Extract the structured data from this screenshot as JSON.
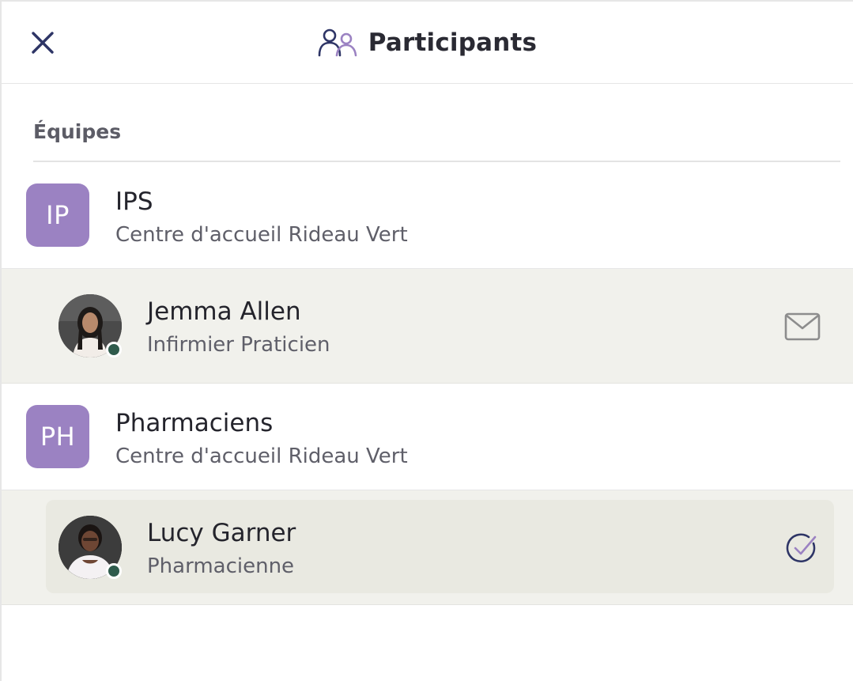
{
  "header": {
    "title": "Participants",
    "close_icon": "close-icon",
    "title_icon": "participants-icon"
  },
  "section": {
    "label": "Équipes"
  },
  "teams": [
    {
      "initials": "IP",
      "name": "IPS",
      "location": "Centre d'accueil Rideau Vert",
      "member": {
        "name": "Jemma Allen",
        "role": "Infirmier Praticien",
        "status": "online",
        "action_icon": "mail-icon"
      }
    },
    {
      "initials": "PH",
      "name": "Pharmaciens",
      "location": "Centre d'accueil Rideau Vert",
      "member": {
        "name": "Lucy Garner",
        "role": "Pharmacienne",
        "status": "online",
        "selected": true,
        "action_icon": "check-circle-icon"
      }
    }
  ],
  "colors": {
    "team_avatar_bg": "#9b82c2",
    "accent_navy": "#2e3566",
    "accent_purple": "#9b82c2",
    "status_online": "#2f5b4c",
    "member_band_bg": "#f1f1ec"
  }
}
